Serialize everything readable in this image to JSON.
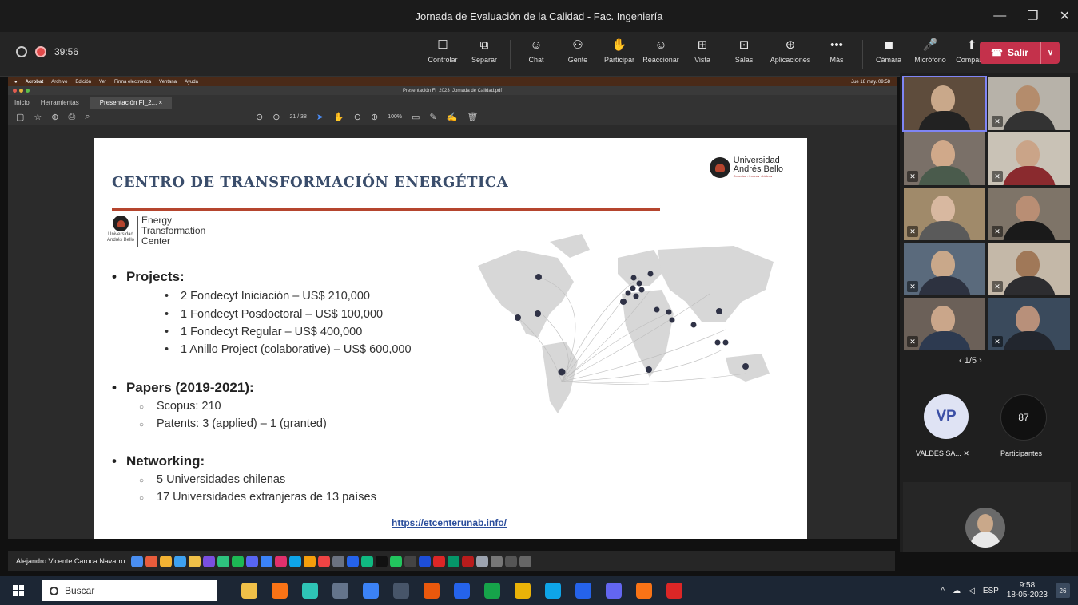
{
  "window": {
    "title": "Jornada de Evaluación de la Calidad - Fac. Ingeniería",
    "minimize": "—",
    "maximize": "❐",
    "close": "✕"
  },
  "meeting": {
    "timer": "39:56",
    "controls": [
      {
        "label": "Controlar",
        "icon": "☐"
      },
      {
        "label": "Separar",
        "icon": "⧉"
      },
      {
        "label": "Chat",
        "icon": "☺"
      },
      {
        "label": "Gente",
        "icon": "⚇"
      },
      {
        "label": "Participar",
        "icon": "✋"
      },
      {
        "label": "Reaccionar",
        "icon": "☺"
      },
      {
        "label": "Vista",
        "icon": "⊞"
      },
      {
        "label": "Salas",
        "icon": "⊡"
      },
      {
        "label": "Aplicaciones",
        "icon": "⊕"
      },
      {
        "label": "Más",
        "icon": "•••"
      },
      {
        "label": "Cámara",
        "icon": "◼"
      },
      {
        "label": "Micrófono",
        "icon": "🎤"
      },
      {
        "label": "Comparte",
        "icon": "⬆"
      }
    ],
    "leave_label": "Salir",
    "leave_caret": "∨"
  },
  "mac": {
    "menubar": [
      "Acrobat",
      "Archivo",
      "Edición",
      "Ver",
      "Firma electrónica",
      "Ventana",
      "Ayuda"
    ],
    "menubar_clock": "Jue 18 may. 09:58",
    "doc_title": "Presentación FI_2023_Jornada de Calidad.pdf",
    "tabs": [
      "Inicio",
      "Herramientas"
    ],
    "active_tab": "Presentación FI_2...  ×",
    "page_indicator": "21 / 38",
    "zoom": "100%"
  },
  "slide": {
    "title": "CENTRO DE TRANSFORMACIÓN ENERGÉTICA",
    "unab_logo": {
      "line1": "Universidad",
      "line2": "Andrés Bello",
      "tagline": "Conectar - Innovar - Liderar"
    },
    "etc_logo": {
      "uni1": "Universidad",
      "uni2": "Andrés Bello",
      "name1": "Energy",
      "name2": "Transformation",
      "name3": "Center"
    },
    "projects_heading": "Projects:",
    "projects": [
      "2 Fondecyt Iniciación – US$ 210,000",
      "1 Fondecyt Posdoctoral – US$ 100,000",
      "1 Fondecyt Regular – US$ 400,000",
      "1 Anillo Project (colaborative) – US$ 600,000"
    ],
    "papers_heading": "Papers (2019-2021):",
    "papers": [
      "Scopus: 210",
      "Patents: 3 (applied) – 1 (granted)"
    ],
    "networking_heading": "Networking:",
    "networking": [
      "5 Universidades chilenas",
      "17 Universidades extranjeras de 13 países"
    ],
    "link": "https://etcenterunab.info/"
  },
  "participants": {
    "pager": "‹  1/5  ›",
    "vp_initials": "VP",
    "vp_name": "VALDES SA...",
    "count": "87",
    "count_label": "Participantes"
  },
  "dock": {
    "presenter": "Alejandro Vicente Caroca Navarro"
  },
  "taskbar": {
    "search_placeholder": "Buscar",
    "lang": "ESP",
    "time": "9:58",
    "date": "18-05-2023",
    "notifications": "26"
  }
}
